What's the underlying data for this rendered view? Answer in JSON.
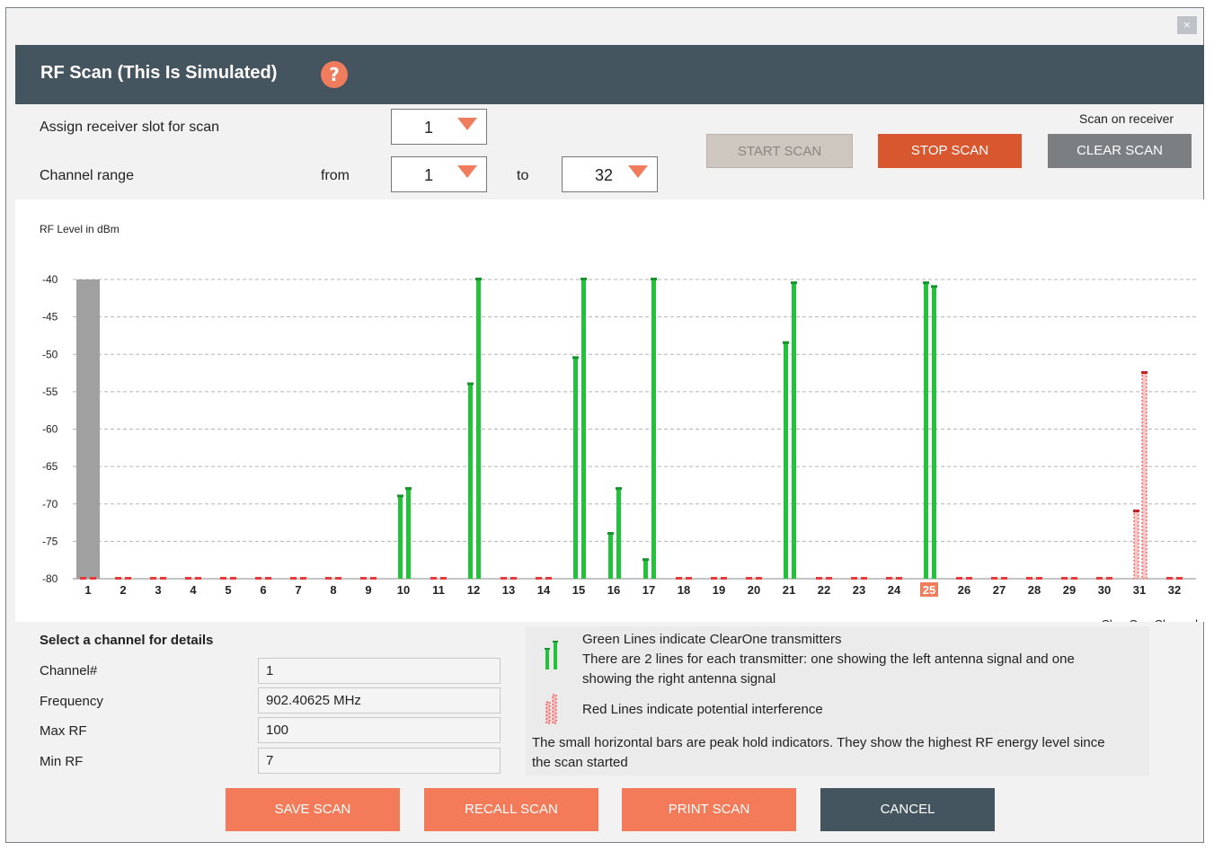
{
  "window": {
    "close_label": "×"
  },
  "header": {
    "title": "RF Scan  (This Is Simulated)",
    "help_icon": "question-icon",
    "help_glyph": "?"
  },
  "controls": {
    "slot_label": "Assign receiver slot for scan",
    "slot_value": "1",
    "range_label": "Channel range",
    "from_label": "from",
    "from_value": "1",
    "to_label": "to",
    "to_value": "32",
    "scan_on_receiver": "Scan on receiver",
    "start_scan": "START SCAN",
    "stop_scan": "STOP SCAN",
    "clear_scan": "CLEAR SCAN"
  },
  "colors": {
    "accent": "#f07c5e",
    "stop": "#d9572f",
    "dark": "#45555f",
    "green": "#22c23a",
    "red": "#e83a3a",
    "grey_button": "#7b7f82",
    "disabled": "#cdc7c0"
  },
  "chart_data": {
    "type": "bar",
    "ylabel": "RF Level in dBm",
    "xlabel": "ClearOne Channel",
    "ylim": [
      -80,
      -40
    ],
    "yticks": [
      "-40",
      "-45",
      "-50",
      "-55",
      "-60",
      "-65",
      "-70",
      "-75",
      "-80"
    ],
    "categories": [
      "1",
      "2",
      "3",
      "4",
      "5",
      "6",
      "7",
      "8",
      "9",
      "10",
      "11",
      "12",
      "13",
      "14",
      "15",
      "16",
      "17",
      "18",
      "19",
      "20",
      "21",
      "22",
      "23",
      "24",
      "25",
      "26",
      "27",
      "28",
      "29",
      "30",
      "31",
      "32"
    ],
    "selected_channel": "1",
    "highlighted_channel": "25",
    "series": [
      {
        "name": "Green Lines indicate ClearOne transmitters",
        "color": "#22c23a",
        "pairs": {
          "10": [
            -69,
            -68
          ],
          "12": [
            -54,
            -40
          ],
          "15": [
            -50.5,
            -40
          ],
          "16": [
            -74,
            -68
          ],
          "17": [
            -77.5,
            -40
          ],
          "21": [
            -48.5,
            -40.5
          ],
          "25": [
            -40.5,
            -41
          ]
        }
      },
      {
        "name": "Red Lines indicate potential interference",
        "color": "#e83a3a",
        "pairs": {
          "31": [
            -71,
            -52.5
          ]
        }
      }
    ]
  },
  "details": {
    "title": "Select a channel for details",
    "channel_label": "Channel#",
    "channel_value": "1",
    "frequency_label": "Frequency",
    "frequency_value": "902.40625 MHz",
    "max_label": "Max RF",
    "max_value": "100",
    "min_label": "Min RF",
    "min_value": "7"
  },
  "legend": {
    "green_line1": "Green Lines indicate ClearOne transmitters",
    "green_line2": "There are 2 lines for each transmitter: one showing the left antenna signal and one",
    "green_line3": "showing the right antenna signal",
    "red_line": "Red Lines indicate potential interference",
    "peak_line1": "The small horizontal bars are peak hold indicators. They show the highest RF energy level since",
    "peak_line2": "the scan started"
  },
  "footer": {
    "save": "SAVE SCAN",
    "recall": "RECALL SCAN",
    "print": "PRINT SCAN",
    "cancel": "CANCEL"
  }
}
